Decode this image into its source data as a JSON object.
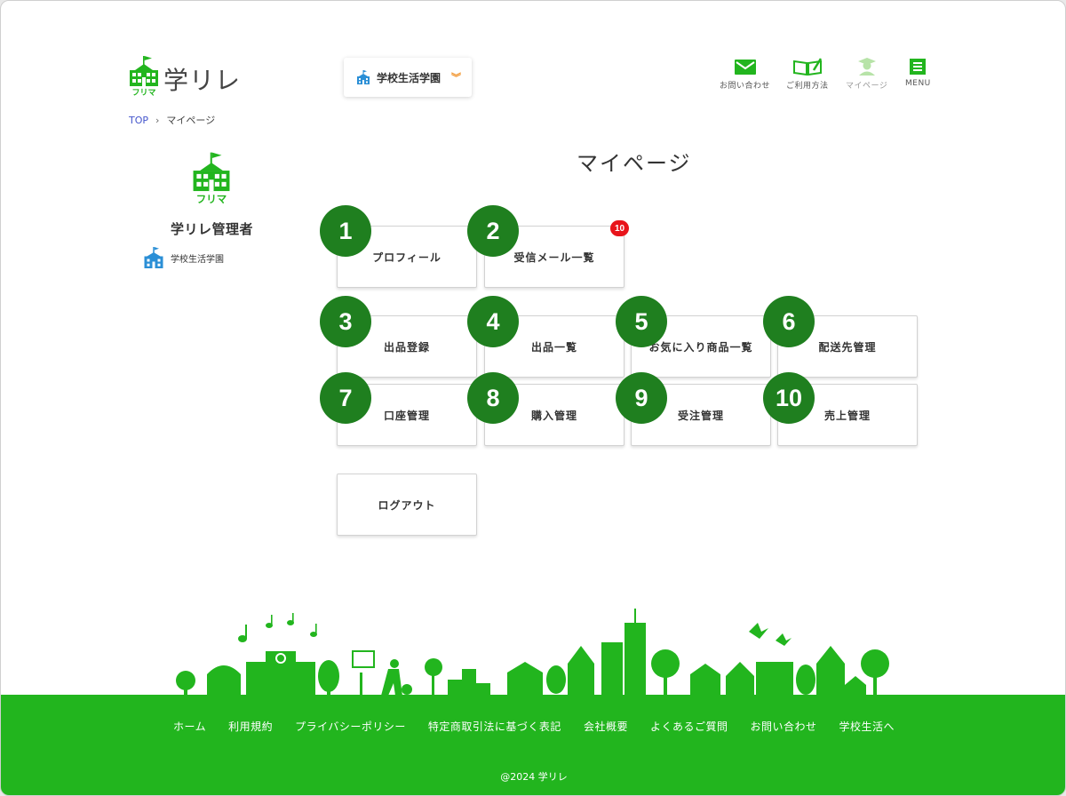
{
  "header": {
    "logo_text": "学リレ",
    "logo_sub": "フリマ",
    "school_selector": "学校生活学園",
    "nav": [
      {
        "label": "お問い合わせ",
        "icon": "mail-icon"
      },
      {
        "label": "ご利用方法",
        "icon": "book-icon"
      },
      {
        "label": "マイページ",
        "icon": "student-icon"
      },
      {
        "label": "MENU",
        "icon": "menu-icon"
      }
    ]
  },
  "breadcrumb": {
    "top": "TOP",
    "current": "マイページ"
  },
  "sidebar": {
    "logo_sub": "フリマ",
    "admin_name": "学リレ管理者",
    "school": "学校生活学園"
  },
  "main": {
    "title": "マイページ",
    "unread_badge": "10",
    "menu": [
      {
        "num": "1",
        "label": "プロフィール"
      },
      {
        "num": "2",
        "label": "受信メール一覧"
      },
      {
        "num": "3",
        "label": "出品登録"
      },
      {
        "num": "4",
        "label": "出品一覧"
      },
      {
        "num": "5",
        "label": "お気に入り商品一覧"
      },
      {
        "num": "6",
        "label": "配送先管理"
      },
      {
        "num": "7",
        "label": "口座管理"
      },
      {
        "num": "8",
        "label": "購入管理"
      },
      {
        "num": "9",
        "label": "受注管理"
      },
      {
        "num": "10",
        "label": "売上管理"
      }
    ],
    "logout": "ログアウト"
  },
  "colors": {
    "brand_green": "#22b51e",
    "number_green": "#1f7f1f",
    "badge_red": "#e8141b",
    "accent_orange": "#f08c1d",
    "school_blue": "#2b8fd6"
  },
  "footer": {
    "links": [
      "ホーム",
      "利用規約",
      "プライバシーポリシー",
      "特定商取引法に基づく表記",
      "会社概要",
      "よくあるご質問",
      "お問い合わせ",
      "学校生活へ"
    ],
    "copyright": "@2024 学リレ"
  }
}
